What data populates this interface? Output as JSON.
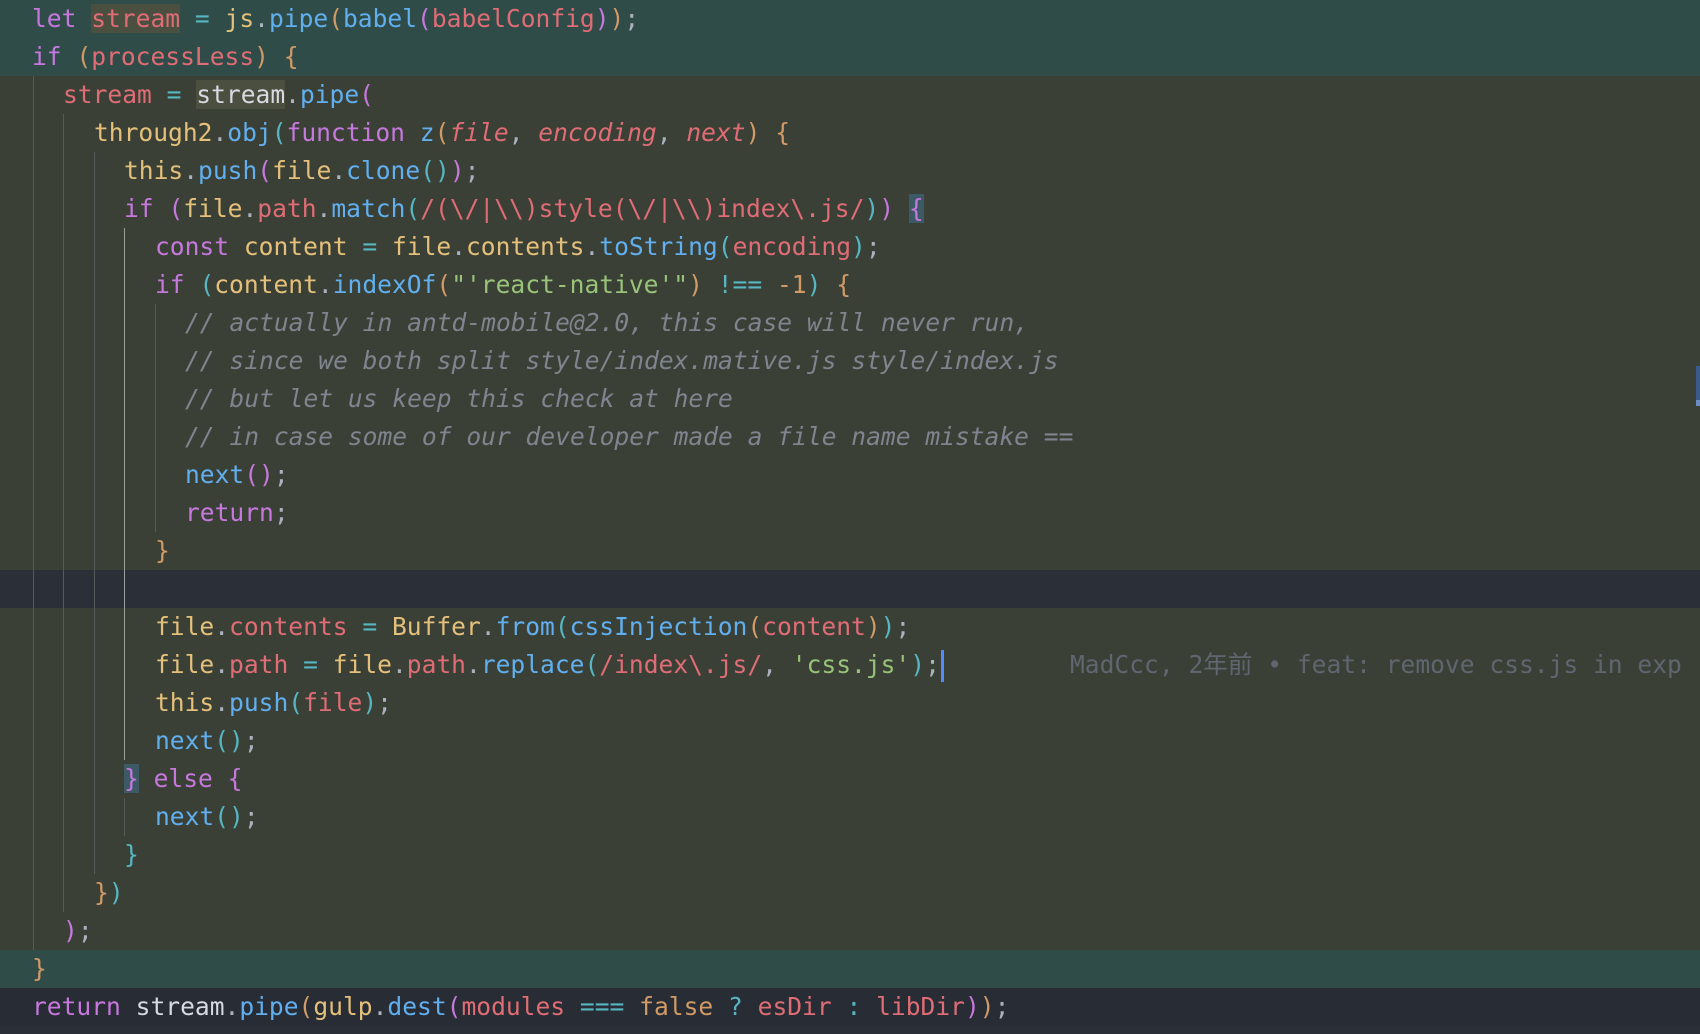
{
  "editor": {
    "lines": [
      "let stream = js.pipe(babel(babelConfig));",
      "if (processLess) {",
      "stream = stream.pipe(",
      "through2.obj(function z(file, encoding, next) {",
      "this.push(file.clone());",
      "if (file.path.match(/(\\/|\\\\)style(\\/|\\\\)index\\.js/)) {",
      "const content = file.contents.toString(encoding);",
      "if (content.indexOf(\"'react-native'\") !== -1) {",
      "// actually in antd-mobile@2.0, this case will never run,",
      "// since we both split style/index.mative.js style/index.js",
      "// but let us keep this check at here",
      "// in case some of our developer made a file name mistake ==",
      "next();",
      "return;",
      "}",
      "",
      "file.contents = Buffer.from(cssInjection(content));",
      "file.path = file.path.replace(/index\\.js/, 'css.js');",
      "this.push(file);",
      "next();",
      "} else {",
      "next();",
      "}",
      "})",
      ");",
      "}",
      "return stream.pipe(gulp.dest(modules === false ? esDir : libDir));"
    ],
    "blame_annotation": "MadCcc, 2年前 • feat: remove css.js in exp",
    "colors": {
      "background": "#2a2e36",
      "line_highlight_green": "#2f4c48",
      "line_highlight_olive": "#3a4036",
      "cursor": "#528bff"
    }
  }
}
